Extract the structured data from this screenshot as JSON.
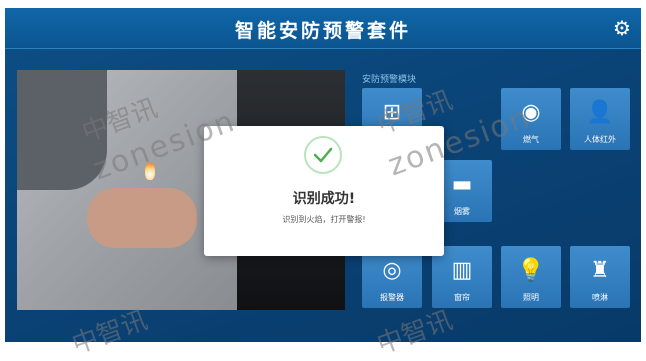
{
  "header": {
    "title": "智能安防预警套件"
  },
  "settings_icon": "gear-icon",
  "section_label": "安防预警模块",
  "tiles": [
    {
      "label": "",
      "icon": "hidden-tile-icon"
    },
    {
      "label": "燃气",
      "icon": "gas-sensor-icon"
    },
    {
      "label": "人体红外",
      "icon": "person-icon"
    },
    {
      "label": "",
      "icon": "hidden-tile-icon"
    },
    {
      "label": "烟雾",
      "icon": "smoke-icon"
    },
    {
      "label": "报警器",
      "icon": "alarm-icon"
    },
    {
      "label": "窗帘",
      "icon": "curtain-icon"
    },
    {
      "label": "照明",
      "icon": "bulb-icon"
    },
    {
      "label": "喷淋",
      "icon": "sprinkler-icon"
    }
  ],
  "modal": {
    "title": "识别成功!",
    "message": "识别到火焰，打开警报!"
  },
  "watermark": {
    "cn": "中智讯",
    "en": "zonesion"
  },
  "colors": {
    "background": "#0a4275",
    "tile": "#3a86c6",
    "success": "#4caf50"
  }
}
